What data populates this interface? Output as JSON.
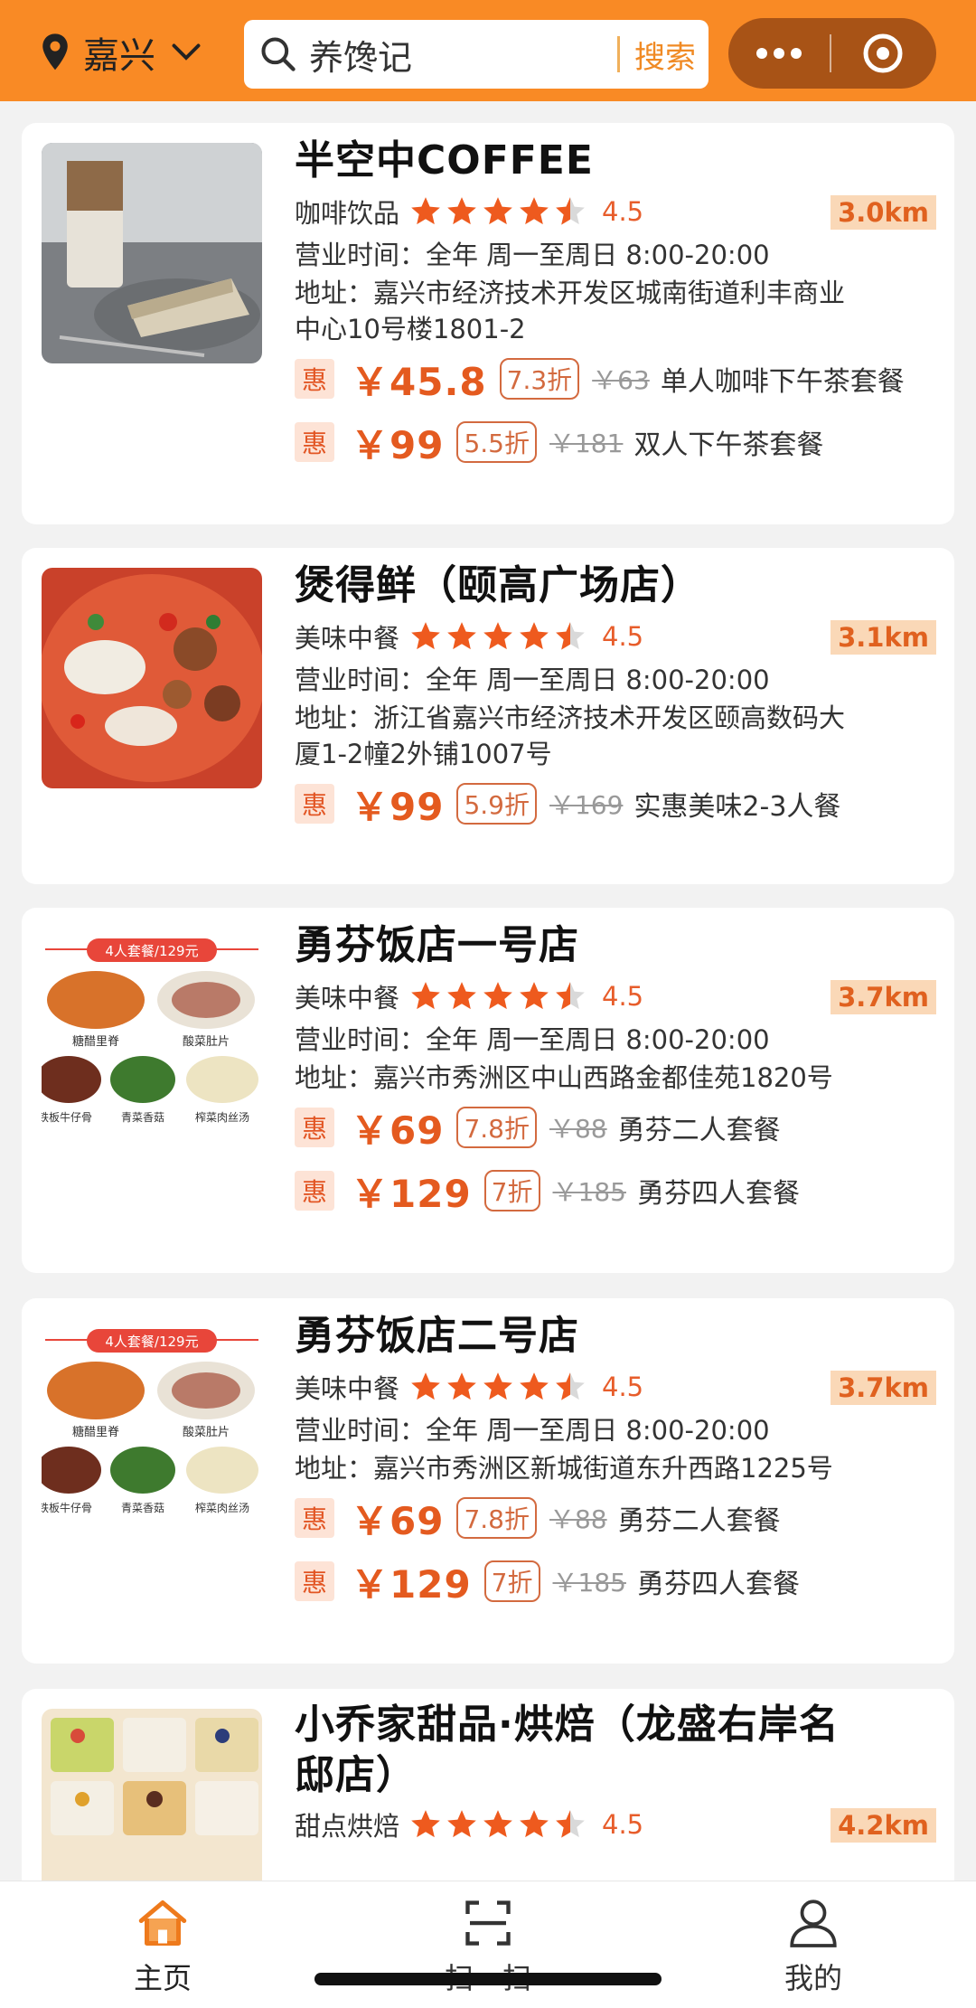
{
  "header": {
    "city": "嘉兴",
    "search_value": "养馋记",
    "search_button": "搜索",
    "colors": {
      "bar": "#f98a25",
      "capsule": "#a85316",
      "accent": "#e45a1f"
    }
  },
  "restaurants": [
    {
      "name": "半空中COFFEE",
      "category": "咖啡饮品",
      "rating": "4.5",
      "distance": "3.0km",
      "hours": "营业时间：全年 周一至周日 8:00-20:00",
      "address_line1": "地址：嘉兴市经济技术开发区城南街道利丰商业",
      "address_line2": "中心10号楼1801-2",
      "deals": [
        {
          "badge": "惠",
          "price": "￥45.8",
          "discount": "7.3折",
          "original": "￥63",
          "package": "单人咖啡下午茶套餐"
        },
        {
          "badge": "惠",
          "price": "￥99",
          "discount": "5.5折",
          "original": "￥181",
          "package": "双人下午茶套餐"
        }
      ]
    },
    {
      "name": "煲得鲜（颐高广场店）",
      "category": "美味中餐",
      "rating": "4.5",
      "distance": "3.1km",
      "hours": "营业时间：全年 周一至周日 8:00-20:00",
      "address_line1": "地址：浙江省嘉兴市经济技术开发区颐高数码大",
      "address_line2": "厦1-2幢2外铺1007号",
      "deals": [
        {
          "badge": "惠",
          "price": "￥99",
          "discount": "5.9折",
          "original": "￥169",
          "package": "实惠美味2-3人餐"
        }
      ]
    },
    {
      "name": "勇芬饭店一号店",
      "category": "美味中餐",
      "rating": "4.5",
      "distance": "3.7km",
      "hours": "营业时间：全年 周一至周日 8:00-20:00",
      "address_line1": "地址：嘉兴市秀洲区中山西路金都佳苑1820号",
      "thumb_text": {
        "banner": "4人套餐/129元",
        "d1": "糖醋里脊",
        "d2": "酸菜肚片",
        "d3": "铁板牛仔骨",
        "d4": "青菜香菇",
        "d5": "榨菜肉丝汤"
      },
      "deals": [
        {
          "badge": "惠",
          "price": "￥69",
          "discount": "7.8折",
          "original": "￥88",
          "package": "勇芬二人套餐"
        },
        {
          "badge": "惠",
          "price": "￥129",
          "discount": "7折",
          "original": "￥185",
          "package": "勇芬四人套餐"
        }
      ]
    },
    {
      "name": "勇芬饭店二号店",
      "category": "美味中餐",
      "rating": "4.5",
      "distance": "3.7km",
      "hours": "营业时间：全年 周一至周日 8:00-20:00",
      "address_line1": "地址：嘉兴市秀洲区新城街道东升西路1225号",
      "thumb_text": {
        "banner": "4人套餐/129元",
        "d1": "糖醋里脊",
        "d2": "酸菜肚片",
        "d3": "铁板牛仔骨",
        "d4": "青菜香菇",
        "d5": "榨菜肉丝汤"
      },
      "deals": [
        {
          "badge": "惠",
          "price": "￥69",
          "discount": "7.8折",
          "original": "￥88",
          "package": "勇芬二人套餐"
        },
        {
          "badge": "惠",
          "price": "￥129",
          "discount": "7折",
          "original": "￥185",
          "package": "勇芬四人套餐"
        }
      ]
    },
    {
      "name_line1": "小乔家甜品·烘焙（龙盛右岸名",
      "name_line2": "邸店）",
      "category": "甜点烘焙",
      "rating": "4.5",
      "distance": "4.2km"
    }
  ],
  "tabbar": {
    "home": "主页",
    "scan": "扫一扫",
    "mine": "我的"
  }
}
